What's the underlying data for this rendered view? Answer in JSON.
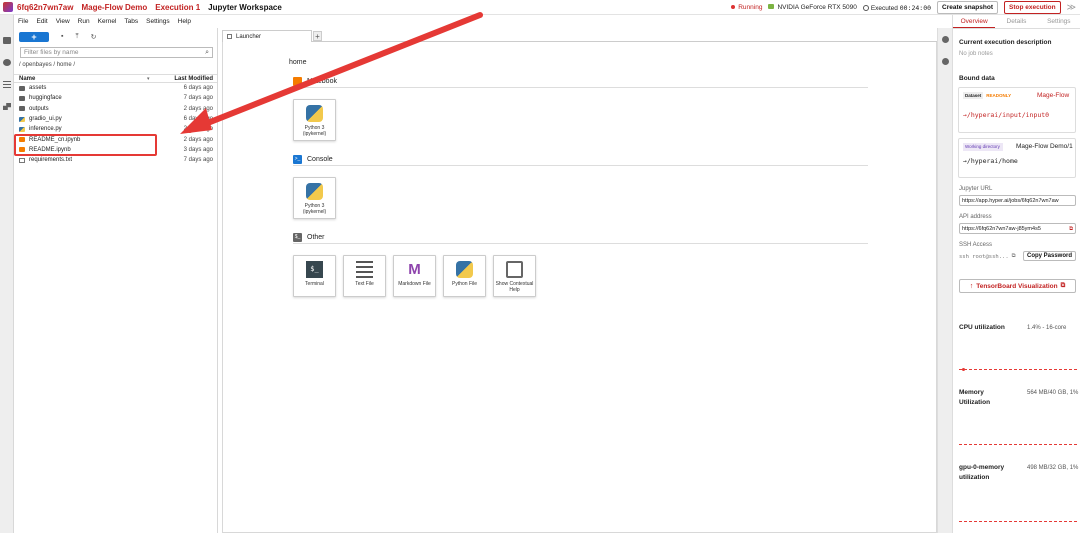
{
  "header": {
    "job_id": "6fq62n7wn7aw",
    "project": "Mage-Flow Demo",
    "execution": "Execution 1",
    "workspace": "Jupyter Workspace",
    "status": "Running",
    "gpu": "NVIDIA GeForce RTX 5090",
    "executed_label": "Executed",
    "executed_time": "00:24:00",
    "create_snapshot": "Create snapshot",
    "stop_execution": "Stop execution",
    "collapse": "≫"
  },
  "menu": [
    "File",
    "Edit",
    "View",
    "Run",
    "Kernel",
    "Tabs",
    "Settings",
    "Help"
  ],
  "filebrowser": {
    "new_label": "+",
    "filter_placeholder": "Filter files by name",
    "path": "/ openbayes / home /",
    "col_name": "Name",
    "col_modified": "Last Modified",
    "files": [
      {
        "name": "assets",
        "type": "folder",
        "modified": "6 days ago"
      },
      {
        "name": "huggingface",
        "type": "folder",
        "modified": "7 days ago"
      },
      {
        "name": "outputs",
        "type": "folder",
        "modified": "2 days ago"
      },
      {
        "name": "gradio_ui.py",
        "type": "py",
        "modified": "6 days ago"
      },
      {
        "name": "inference.py",
        "type": "py",
        "modified": "2 days ago"
      },
      {
        "name": "README_cn.ipynb",
        "type": "nb",
        "modified": "2 days ago"
      },
      {
        "name": "README.ipynb",
        "type": "nb",
        "modified": "3 days ago"
      },
      {
        "name": "requirements.txt",
        "type": "txt",
        "modified": "7 days ago"
      }
    ]
  },
  "launcher": {
    "tab_label": "Launcher",
    "home": "home",
    "notebook_section": "Notebook",
    "console_section": "Console",
    "other_section": "Other",
    "python_kernel": "Python 3",
    "python_kernel_sub": "(ipykernel)",
    "other_items": [
      "Terminal",
      "Text File",
      "Markdown File",
      "Python File",
      "Show Contextual Help"
    ]
  },
  "panel": {
    "tabs": [
      "Overview",
      "Details",
      "Settings"
    ],
    "exec_desc_title": "Current execution description",
    "no_notes": "No job notes",
    "bound_title": "Bound data",
    "dataset_tag": "Dataset",
    "readonly_tag": "READONLY",
    "dataset_name": "Mage-Flow",
    "dataset_path": "→/hyperai/input/input0",
    "workdir_tag": "Working directory",
    "workdir_name": "Mage-Flow Demo/1",
    "workdir_path": "→/hyperai/home",
    "jupyter_url_label": "Jupyter URL",
    "jupyter_url": "https://app.hyper.ai/jobs/6fq62n7wn7aw",
    "api_label": "API address",
    "api_url": "https://6fq62n7wn7aw-j85ym4s5",
    "ssh_label": "SSH Access",
    "ssh_cmd": "ssh root@ssh...",
    "copy_password": "Copy Password",
    "tensorboard": "TensorBoard Visualization",
    "cpu_label": "CPU utilization",
    "cpu_value": "1.4% - 16-core",
    "mem_label": "Memory Utilization",
    "mem_value": "564 MB/40 GB, 1%",
    "gpu_mem_label": "gpu-0-memory utilization",
    "gpu_mem_value": "498 MB/32 GB, 1%"
  },
  "colors": {
    "brand_red": "#c22222",
    "accent_blue": "#1976d2",
    "highlight": "#e53935"
  }
}
